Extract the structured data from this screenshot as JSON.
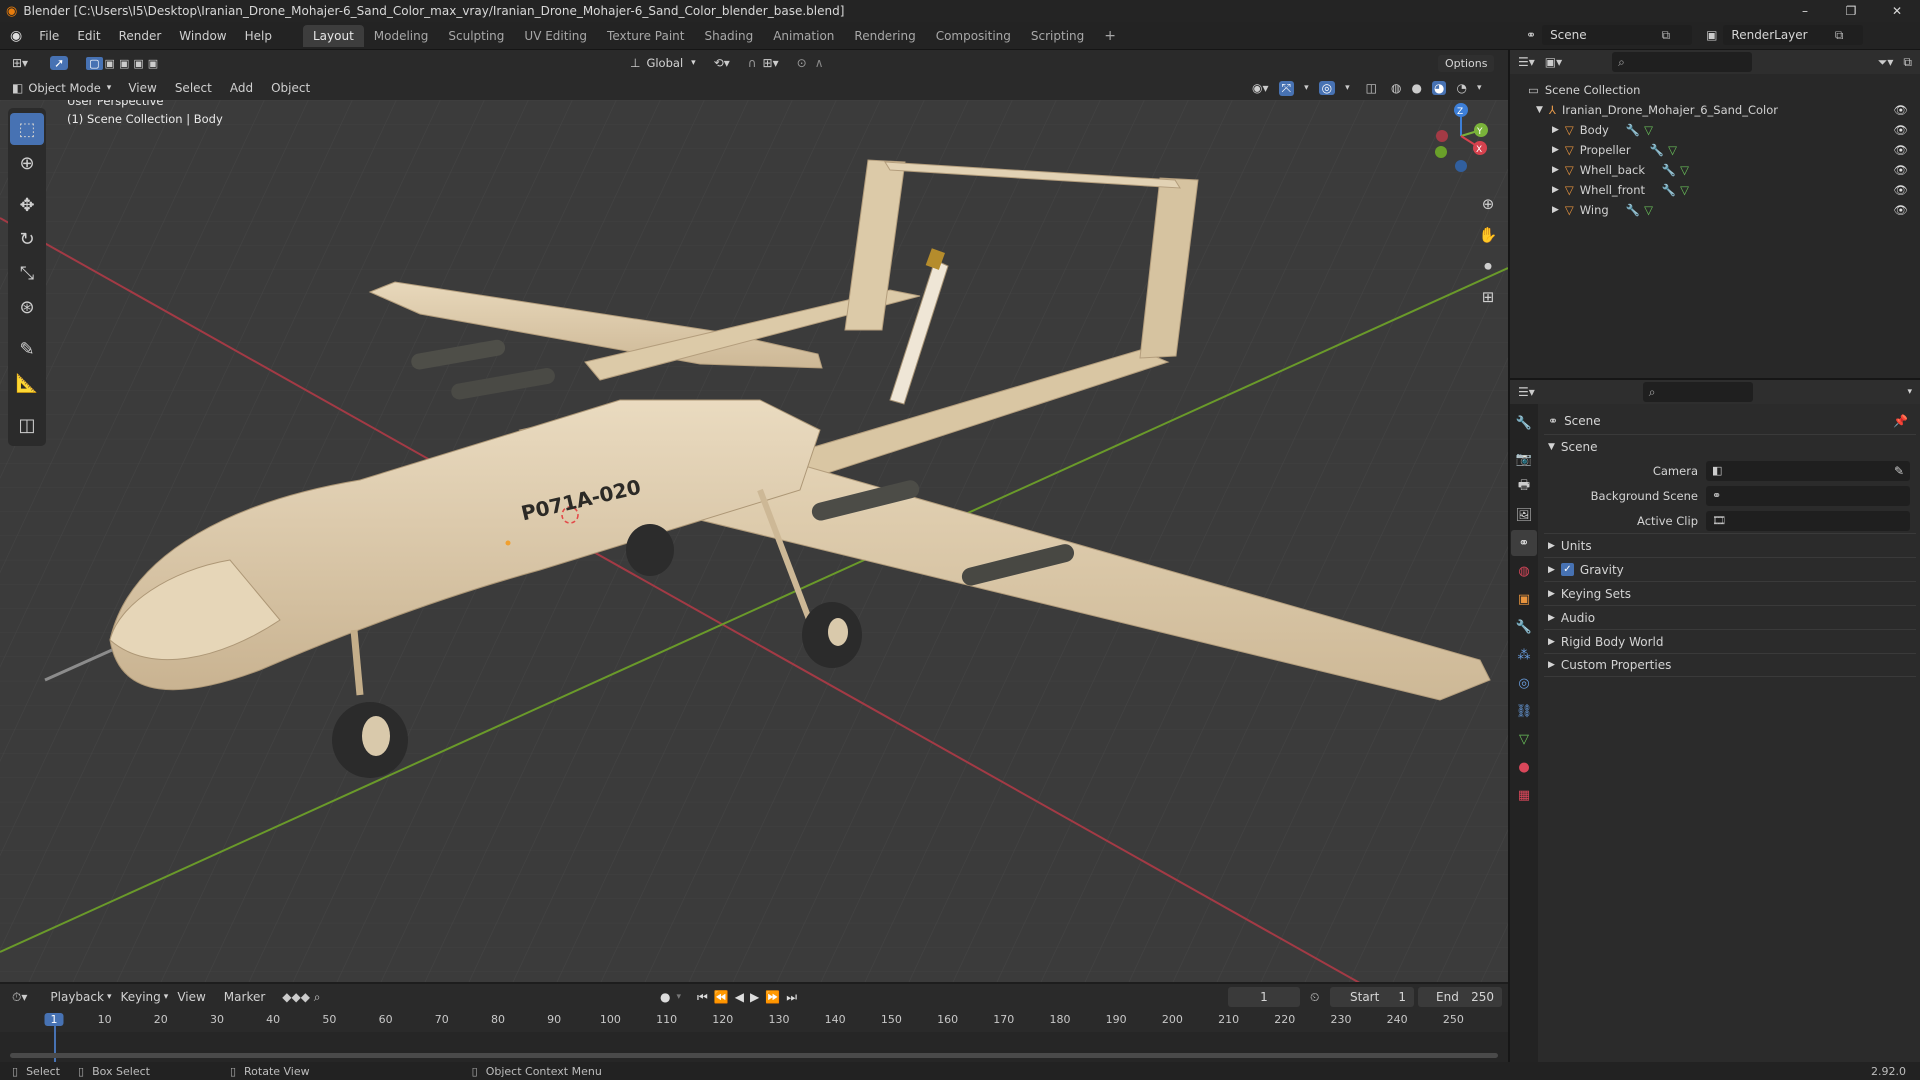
{
  "window": {
    "title": "Blender [C:\\Users\\I5\\Desktop\\Iranian_Drone_Mohajer-6_Sand_Color_max_vray/Iranian_Drone_Mohajer-6_Sand_Color_blender_base.blend]",
    "controls": [
      "–",
      "❐",
      "✕"
    ]
  },
  "menu": {
    "items": [
      "File",
      "Edit",
      "Render",
      "Window",
      "Help"
    ],
    "workspaces": [
      "Layout",
      "Modeling",
      "Sculpting",
      "UV Editing",
      "Texture Paint",
      "Shading",
      "Animation",
      "Rendering",
      "Compositing",
      "Scripting"
    ],
    "active_workspace": "Layout",
    "add_tab": "+",
    "scene_label": "Scene",
    "renderlayer_label": "RenderLayer"
  },
  "viewport": {
    "transform_orientation": "Global",
    "options_label": "Options",
    "mode": "Object Mode",
    "header_menus": [
      "View",
      "Select",
      "Add",
      "Object"
    ],
    "overlay_line1": "User Perspective",
    "overlay_line2": "(1) Scene Collection | Body",
    "drone_tail_text": "P071A-020",
    "gizmo_axes": {
      "x": "X",
      "y": "Y",
      "z": "Z"
    },
    "colors": {
      "background": "#3b3b3b",
      "grid": "#464646",
      "x_axis": "#a33a45",
      "y_axis": "#6a9a2a",
      "body": "#dcc7a4"
    }
  },
  "outliner": {
    "root": "Scene Collection",
    "collection": "Iranian_Drone_Mohajer_6_Sand_Color",
    "objects": [
      "Body",
      "Propeller",
      "Whell_back",
      "Whell_front",
      "Wing"
    ]
  },
  "properties": {
    "breadcrumb": "Scene",
    "panel_title": "Scene",
    "fields": [
      {
        "label": "Camera",
        "value": ""
      },
      {
        "label": "Background Scene",
        "value": ""
      },
      {
        "label": "Active Clip",
        "value": ""
      }
    ],
    "subpanels": [
      "Units",
      "Gravity",
      "Keying Sets",
      "Audio",
      "Rigid Body World",
      "Custom Properties"
    ],
    "gravity_checked": true
  },
  "timeline": {
    "menus": [
      "Playback",
      "Keying",
      "View",
      "Marker"
    ],
    "current_frame": "1",
    "start_label": "Start",
    "start_value": "1",
    "end_label": "End",
    "end_value": "250",
    "ruler": [
      "1",
      "10",
      "20",
      "30",
      "40",
      "50",
      "60",
      "70",
      "80",
      "90",
      "100",
      "110",
      "120",
      "130",
      "140",
      "150",
      "160",
      "170",
      "180",
      "190",
      "200",
      "210",
      "220",
      "230",
      "240",
      "250"
    ]
  },
  "statusbar": {
    "items": [
      "Select",
      "Box Select",
      "Rotate View",
      "Object Context Menu"
    ],
    "version": "2.92.0"
  }
}
